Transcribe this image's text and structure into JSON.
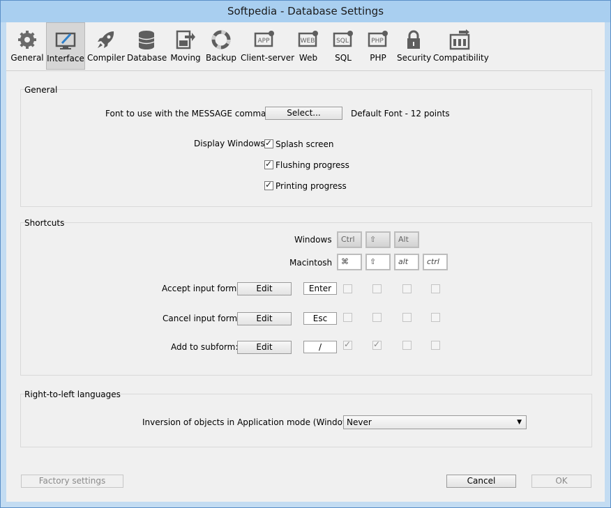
{
  "window": {
    "title": "Softpedia - Database Settings",
    "minimize": "—",
    "maximize": "☐",
    "close": "✕"
  },
  "toolbar": {
    "items": [
      {
        "label": "General",
        "icon": "gear-icon"
      },
      {
        "label": "Interface",
        "icon": "monitor-pencil-icon",
        "selected": true
      },
      {
        "label": "Compiler",
        "icon": "rocket-icon"
      },
      {
        "label": "Database",
        "icon": "database-icon"
      },
      {
        "label": "Moving",
        "icon": "box-arrow-icon"
      },
      {
        "label": "Backup",
        "icon": "lifebuoy-icon"
      },
      {
        "label": "Client-server",
        "icon": "app-icon"
      },
      {
        "label": "Web",
        "icon": "web-icon"
      },
      {
        "label": "SQL",
        "icon": "sql-icon"
      },
      {
        "label": "PHP",
        "icon": "php-icon"
      },
      {
        "label": "Security",
        "icon": "lock-icon"
      },
      {
        "label": "Compatibility",
        "icon": "compatibility-icon"
      }
    ],
    "icon_texts": {
      "app": "APP",
      "web": "WEB",
      "sql": "SQL",
      "php": "PHP"
    }
  },
  "general": {
    "title": "General",
    "font_label": "Font to use with the MESSAGE command:",
    "select_button": "Select...",
    "font_value": "Default Font - 12 points",
    "display_windows_label": "Display Windows:",
    "checkboxes": [
      {
        "label": "Splash screen",
        "checked": true
      },
      {
        "label": "Flushing progress",
        "checked": true
      },
      {
        "label": "Printing progress",
        "checked": true
      }
    ]
  },
  "shortcuts": {
    "title": "Shortcuts",
    "windows_label": "Windows",
    "macintosh_label": "Macintosh",
    "windows_keys": [
      "Ctrl",
      "⇧",
      "Alt"
    ],
    "mac_keys": [
      "⌘",
      "⇧",
      "alt",
      "ctrl"
    ],
    "rows": [
      {
        "label": "Accept input form:",
        "edit": "Edit",
        "key": "Enter",
        "mods": [
          false,
          false,
          false,
          false
        ]
      },
      {
        "label": "Cancel input form:",
        "edit": "Edit",
        "key": "Esc",
        "mods": [
          false,
          false,
          false,
          false
        ]
      },
      {
        "label": "Add to subform:",
        "edit": "Edit",
        "key": "/",
        "mods": [
          true,
          true,
          false,
          false
        ]
      }
    ]
  },
  "rtl": {
    "title": "Right-to-left languages",
    "inversion_label": "Inversion of objects in Application mode (Windows):",
    "inversion_value": "Never"
  },
  "footer": {
    "factory": "Factory settings",
    "cancel": "Cancel",
    "ok": "OK"
  },
  "colors": {
    "titlebar": "#a9cff0",
    "frame": "#c3dcf2",
    "client": "#f0f0f0"
  }
}
